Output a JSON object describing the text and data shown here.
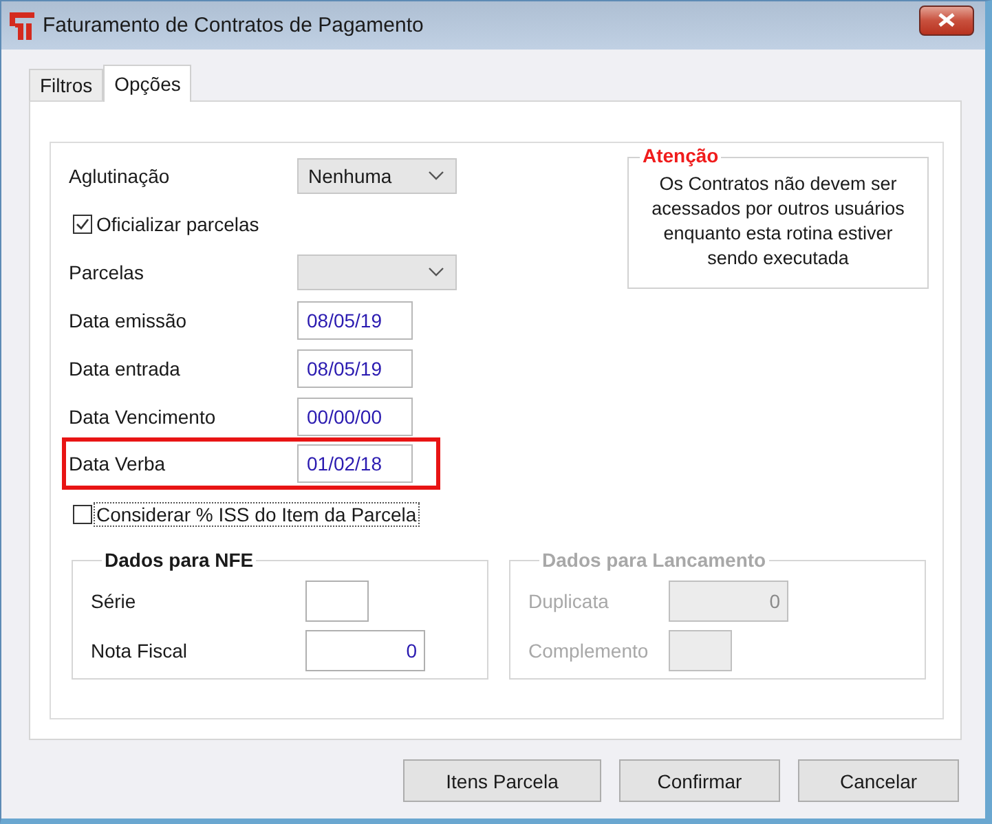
{
  "window": {
    "title": "Faturamento de Contratos de Pagamento"
  },
  "tabs": [
    {
      "label": "Filtros",
      "selected": false
    },
    {
      "label": "Opções",
      "selected": true
    }
  ],
  "fields": [
    {
      "kind": "select",
      "label": "Aglutinação",
      "value": "Nenhuma"
    },
    {
      "kind": "checkbox",
      "label": "Oficializar parcelas",
      "checked": true,
      "focused": false
    },
    {
      "kind": "select",
      "label": "Parcelas"
    },
    {
      "kind": "date",
      "label": "Data emissão",
      "value": "08/05/19",
      "highlighted": false
    },
    {
      "kind": "date",
      "label": "Data entrada",
      "value": "08/05/19",
      "highlighted": false
    },
    {
      "kind": "date",
      "label": "Data Vencimento",
      "value": "00/00/00",
      "highlighted": false
    },
    {
      "kind": "date",
      "label": "Data Verba",
      "value": "01/02/18",
      "highlighted": true
    },
    {
      "kind": "checkbox",
      "label": "Considerar % ISS do Item da Parcela",
      "checked": false,
      "focused": true
    }
  ],
  "attention": {
    "title": "Atenção",
    "message": "Os Contratos não devem ser acessados por outros usuários enquanto esta rotina estiver sendo executada"
  },
  "groups": [
    {
      "title": "Dados para NFE",
      "disabled": false,
      "fields": [
        {
          "label": "Série",
          "kind": "short"
        },
        {
          "label": "Nota Fiscal",
          "kind": "long",
          "value": "0"
        }
      ]
    },
    {
      "title": "Dados para Lancamento",
      "disabled": true,
      "fields": [
        {
          "label": "Duplicata",
          "kind": "long",
          "value": "0"
        },
        {
          "label": "Complemento",
          "kind": "short"
        }
      ]
    }
  ],
  "buttons": [
    "Itens Parcela",
    "Confirmar",
    "Cancelar"
  ]
}
